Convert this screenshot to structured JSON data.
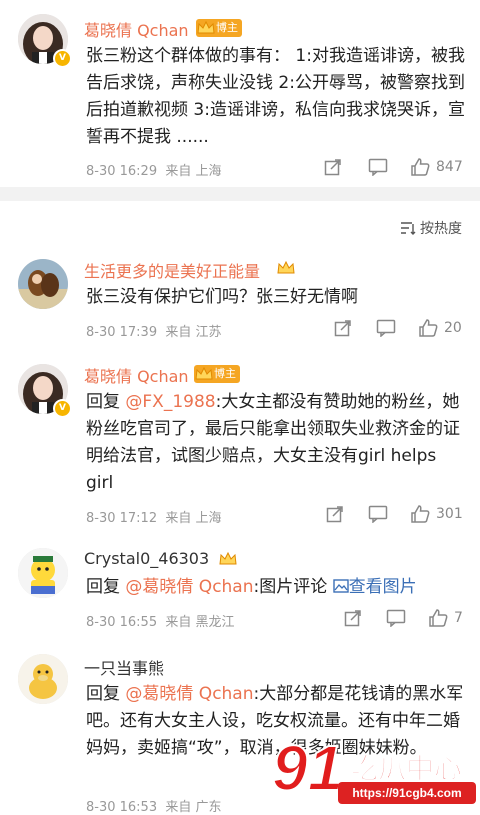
{
  "main_post": {
    "author": "葛晓倩 Qchan",
    "badge": "博主",
    "text": "张三粉这个群体做的事有： 1:对我造谣诽谤，被我告后求饶，声称失业没钱 2:公开辱骂，被警察找到后拍道歉视频 3:造谣诽谤，私信向我求饶哭诉，宣誓再不提我 ......",
    "time": "8-30 16:29",
    "source": "来自 上海",
    "likes": "847"
  },
  "sort_label": "按热度",
  "comments": [
    {
      "author": "生活更多的是美好正能量",
      "text": "张三没有保护它们吗？张三好无情啊",
      "time": "8-30 17:39",
      "source": "来自 江苏",
      "likes": "20"
    },
    {
      "author": "葛晓倩 Qchan",
      "badge": "博主",
      "reply_prefix": "回复",
      "mention": "@FX_1988",
      "text": ":大女主都没有赞助她的粉丝，她粉丝吃官司了，最后只能拿出领取失业救济金的证明给法官，试图少赔点，大女主没有girl helps girl",
      "time": "8-30 17:12",
      "source": "来自 上海",
      "likes": "301"
    },
    {
      "author": "Crystal0_46303",
      "reply_prefix": "回复",
      "mention": "@葛晓倩 Qchan",
      "text": ":图片评论",
      "link": "查看图片",
      "time": "8-30 16:55",
      "source": "来自 黑龙江",
      "likes": "7"
    },
    {
      "author": "一只当事熊",
      "reply_prefix": "回复",
      "mention": "@葛晓倩 Qchan",
      "text": ":大部分都是花钱请的黑水军吧。还有大女主人设，吃女权流量。还有中年二婚妈妈，卖姬搞“攻”，取消，很多姬圈妹妹粉。",
      "time": "8-30 16:53",
      "source": "来自 广东"
    }
  ],
  "watermark": {
    "logo_text": "91吃瓜中心",
    "url": "https://91cgb4.com"
  },
  "colors": {
    "accent": "#eb7350",
    "link": "#3b6fb6",
    "meta": "#999999",
    "divider": "#f2f2f2"
  }
}
